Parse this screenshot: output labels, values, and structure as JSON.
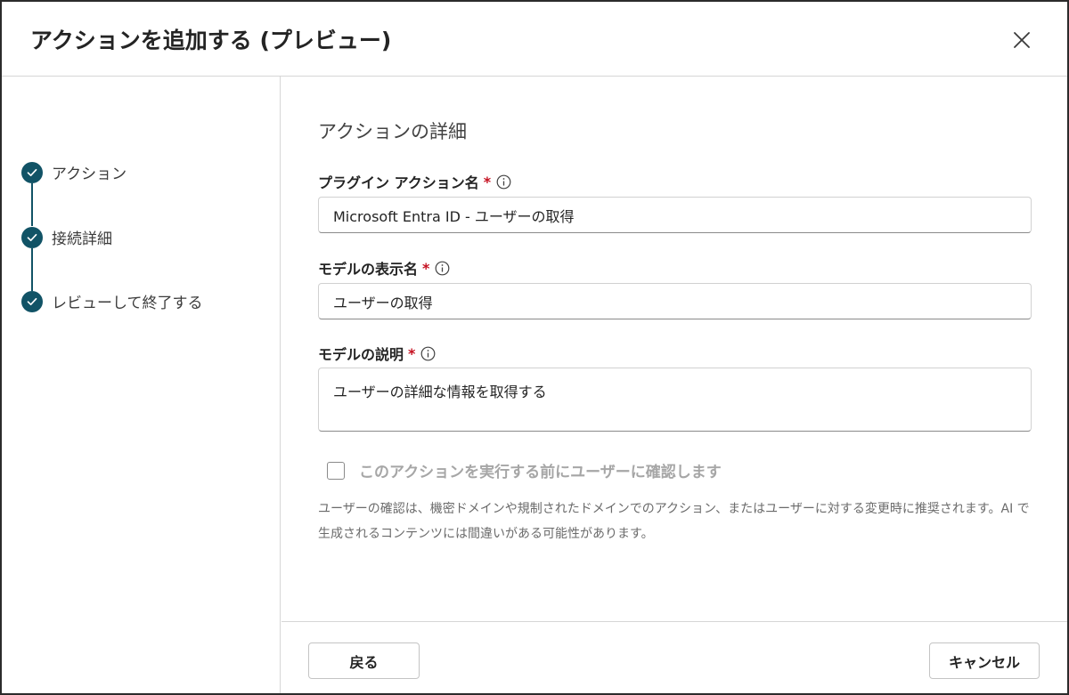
{
  "dialog": {
    "title": "アクションを追加する (プレビュー)"
  },
  "steps": [
    {
      "label": "アクション",
      "status": "completed"
    },
    {
      "label": "接続詳細",
      "status": "completed"
    },
    {
      "label": "レビューして終了する",
      "status": "completed"
    }
  ],
  "form": {
    "section_title": "アクションの詳細",
    "required_marker": "*",
    "plugin_action_name": {
      "label": "プラグイン アクション名",
      "value": "Microsoft Entra ID - ユーザーの取得"
    },
    "model_display_name": {
      "label": "モデルの表示名",
      "value": "ユーザーの取得"
    },
    "model_description": {
      "label": "モデルの説明",
      "value": "ユーザーの詳細な情報を取得する"
    },
    "confirm_checkbox": {
      "label": "このアクションを実行する前にユーザーに確認します",
      "checked": false,
      "disabled": true
    },
    "help_text": "ユーザーの確認は、機密ドメインや規制されたドメインでのアクション、またはユーザーに対する変更時に推奨されます。AI で生成されるコンテンツには間違いがある可能性があります。"
  },
  "footer": {
    "back_label": "戻る",
    "cancel_label": "キャンセル"
  },
  "colors": {
    "accent": "#115366",
    "required": "#c50f1f"
  },
  "icons": {
    "close": "close-icon",
    "step_done": "checkmark-icon",
    "info": "info-icon"
  }
}
